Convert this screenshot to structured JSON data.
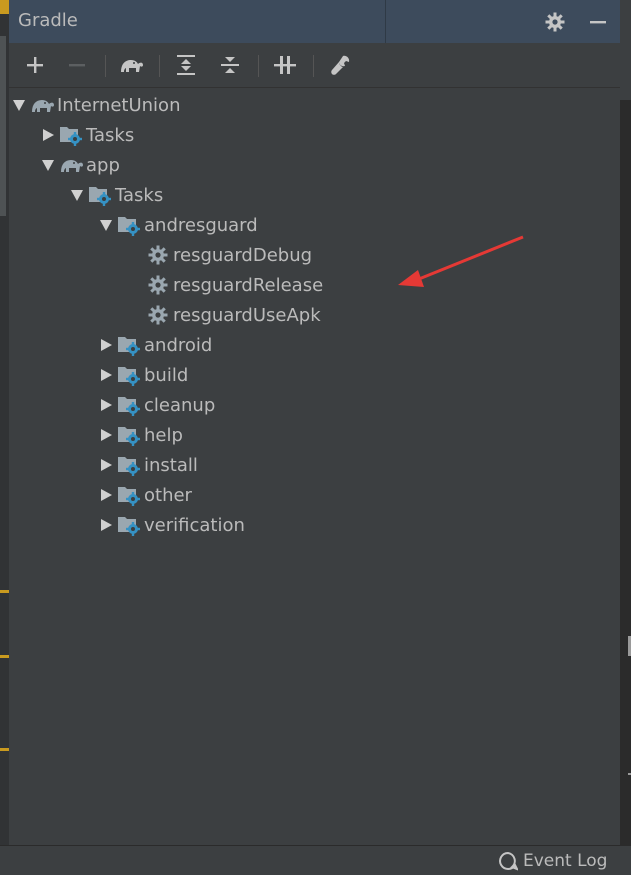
{
  "window": {
    "title": "Gradle"
  },
  "toolbar": {
    "buttons": [
      "add-icon",
      "remove-icon",
      "gradle-elephant-icon",
      "expand-all-icon",
      "collapse-all-icon",
      "toggle-offline-icon",
      "wrench-icon"
    ]
  },
  "tree": {
    "root": "InternetUnion",
    "root_tasks": "Tasks",
    "module": "app",
    "module_tasks": "Tasks",
    "group_open": "andresguard",
    "tasks": [
      "resguardDebug",
      "resguardRelease",
      "resguardUseApk"
    ],
    "groups": [
      "android",
      "build",
      "cleanup",
      "help",
      "install",
      "other",
      "verification"
    ]
  },
  "statusbar": {
    "event_log": "Event Log"
  },
  "colors": {
    "header": "#3d4b5c",
    "panel": "#3c3f41",
    "text": "#bbbbbb",
    "annotation": "#e53935",
    "gear": "#3592c4"
  }
}
